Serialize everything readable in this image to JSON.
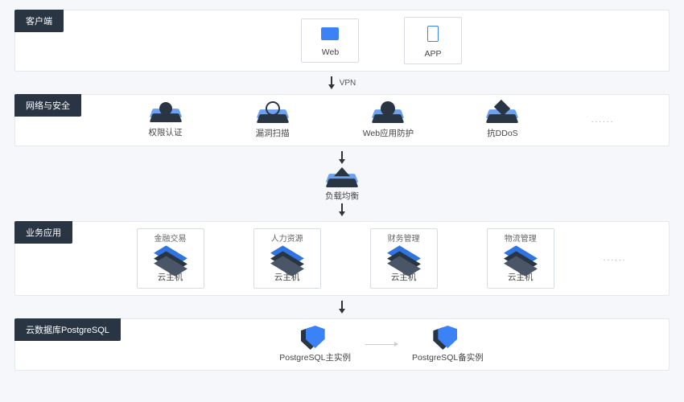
{
  "tiers": {
    "client": {
      "label": "客户端",
      "items": [
        {
          "label": "Web"
        },
        {
          "label": "APP"
        }
      ]
    },
    "vpn_label": "VPN",
    "security": {
      "label": "网络与安全",
      "items": [
        {
          "label": "权限认证"
        },
        {
          "label": "漏洞扫描"
        },
        {
          "label": "Web应用防护"
        },
        {
          "label": "抗DDoS"
        }
      ],
      "more": "......"
    },
    "lb": {
      "label": "负载均衡"
    },
    "apps": {
      "label": "业务应用",
      "groups": [
        {
          "title": "金融交易",
          "host": "云主机"
        },
        {
          "title": "人力资源",
          "host": "云主机"
        },
        {
          "title": "财务管理",
          "host": "云主机"
        },
        {
          "title": "物流管理",
          "host": "云主机"
        }
      ],
      "more": "......"
    },
    "db": {
      "label": "云数据库PostgreSQL",
      "primary": "PostgreSQL主实例",
      "standby": "PostgreSQL备实例"
    }
  }
}
